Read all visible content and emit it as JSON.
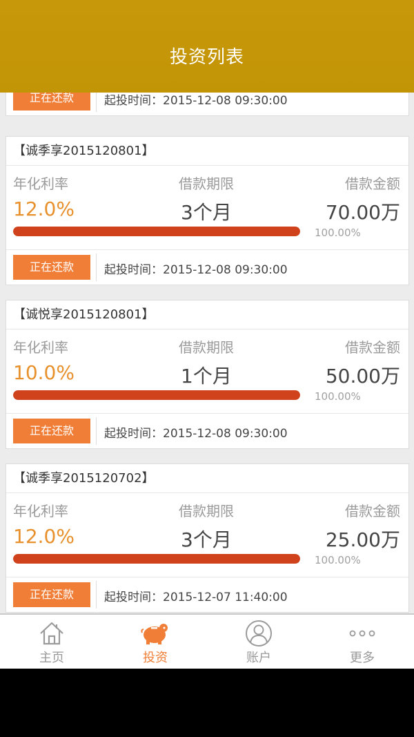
{
  "header": {
    "title": "投资列表"
  },
  "partial_card": {
    "status": "正在还款",
    "start_label": "起投时间：",
    "start_time": "2015-12-08 09:30:00"
  },
  "cards": [
    {
      "title": "【诚季享2015120801】",
      "rate_label": "年化利率",
      "term_label": "借款期限",
      "amount_label": "借款金额",
      "rate": "12.0%",
      "term": "3个月",
      "amount": "70.00万",
      "progress": 1.0,
      "progress_text": "100.00%",
      "status": "正在还款",
      "start_label": "起投时间：",
      "start_time": "2015-12-08 09:30:00"
    },
    {
      "title": "【诚悦享2015120801】",
      "rate_label": "年化利率",
      "term_label": "借款期限",
      "amount_label": "借款金额",
      "rate": "10.0%",
      "term": "1个月",
      "amount": "50.00万",
      "progress": 1.0,
      "progress_text": "100.00%",
      "status": "正在还款",
      "start_label": "起投时间：",
      "start_time": "2015-12-08 09:30:00"
    },
    {
      "title": "【诚季享2015120702】",
      "rate_label": "年化利率",
      "term_label": "借款期限",
      "amount_label": "借款金额",
      "rate": "12.0%",
      "term": "3个月",
      "amount": "25.00万",
      "progress": 1.0,
      "progress_text": "100.00%",
      "status": "正在还款",
      "start_label": "起投时间：",
      "start_time": "2015-12-07 11:40:00"
    }
  ],
  "tabs": [
    {
      "label": "主页",
      "icon": "home-icon",
      "active": false
    },
    {
      "label": "投资",
      "icon": "piggy-bank-icon",
      "active": true
    },
    {
      "label": "账户",
      "icon": "user-icon",
      "active": false
    },
    {
      "label": "更多",
      "icon": "more-dots-icon",
      "active": false
    }
  ],
  "colors": {
    "header": "#c29506",
    "accent_orange": "#f07e37",
    "rate_orange": "#e8902c",
    "progress_red": "#d0421c",
    "inactive_tab": "#999999"
  }
}
